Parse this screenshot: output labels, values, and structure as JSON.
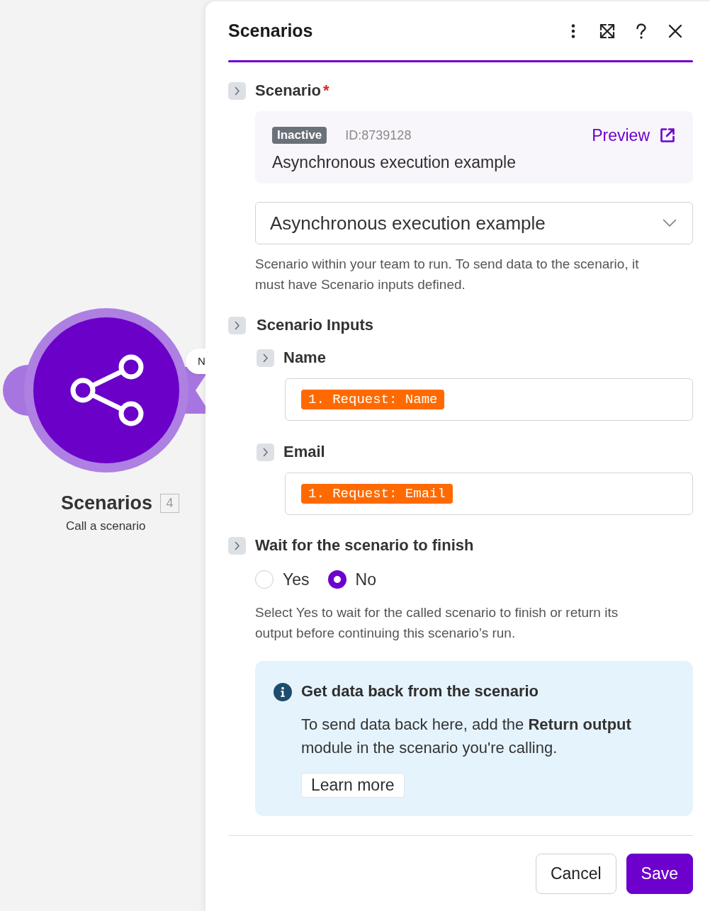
{
  "canvas": {
    "node": {
      "title": "Scenarios",
      "badge": "4",
      "subtitle": "Call a scenario"
    },
    "tooltip": "N"
  },
  "panel": {
    "title": "Scenarios",
    "sections": [
      {
        "kind": "scenario",
        "label": "Scenario",
        "required_mark": "*",
        "card": {
          "status": "Inactive",
          "id": "ID:8739128",
          "link": "Preview",
          "name": "Asynchronous execution example"
        },
        "select": {
          "value": "Asynchronous execution example"
        },
        "help": "Scenario within your team to run. To send data to the scenario, it must have Scenario inputs defined."
      },
      {
        "kind": "inputs",
        "label": "Scenario Inputs",
        "children": [
          {
            "label": "Name",
            "token": "1. Request: Name"
          },
          {
            "label": "Email",
            "token": "1. Request: Email"
          }
        ]
      },
      {
        "kind": "radio",
        "label": "Wait for the scenario to finish",
        "options": [
          {
            "label": "Yes",
            "selected": false
          },
          {
            "label": "No",
            "selected": true
          }
        ],
        "help": "Select Yes to wait for the called scenario to finish or return its output before continuing this scenario’s run."
      }
    ],
    "notice": {
      "title": "Get data back from the scenario",
      "body": "To send data back here, add the **Return output** module in the scenario you're calling.",
      "button": "Learn more"
    },
    "buttons": [
      {
        "label": "Cancel",
        "kind": "secondary"
      },
      {
        "label": "Save",
        "kind": "primary"
      }
    ]
  }
}
